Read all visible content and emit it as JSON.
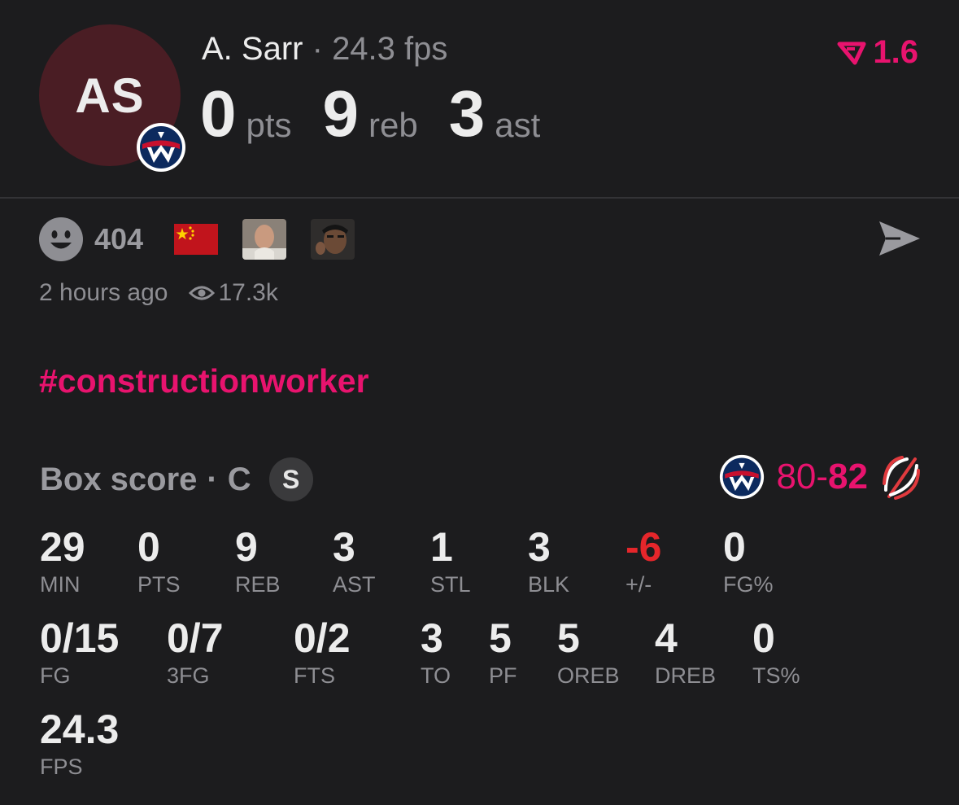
{
  "player": {
    "initials": "AS",
    "name": "A. Sarr",
    "separator": "·",
    "fps_label": "24.3 fps"
  },
  "headline": {
    "pts_value": "0",
    "pts_unit": "pts",
    "reb_value": "9",
    "reb_unit": "reb",
    "ast_value": "3",
    "ast_unit": "ast"
  },
  "rating": {
    "value": "1.6",
    "color": "#e8136e",
    "icon": "v-rating-icon"
  },
  "reactions": {
    "count": "404",
    "icons": [
      "smiley-icon",
      "china-flag-icon",
      "reaction-avatar-1",
      "reaction-avatar-2"
    ],
    "share_icon": "send-icon"
  },
  "meta": {
    "time": "2 hours ago",
    "views": "17.3k"
  },
  "hashtag": "#constructionworker",
  "box_score": {
    "title": "Box score",
    "separator": "·",
    "position": "C",
    "badge": "S",
    "score_away": "80",
    "score_dash": "-",
    "score_home": "82",
    "row1": [
      {
        "value": "29",
        "label": "MIN"
      },
      {
        "value": "0",
        "label": "PTS"
      },
      {
        "value": "9",
        "label": "REB"
      },
      {
        "value": "3",
        "label": "AST"
      },
      {
        "value": "1",
        "label": "STL"
      },
      {
        "value": "3",
        "label": "BLK"
      },
      {
        "value": "-6",
        "label": "+/-"
      },
      {
        "value": "0",
        "label": "FG%"
      }
    ],
    "row2": [
      {
        "value": "0/15",
        "label": "FG"
      },
      {
        "value": "0/7",
        "label": "3FG"
      },
      {
        "value": "0/2",
        "label": "FTS"
      },
      {
        "value": "3",
        "label": "TO"
      },
      {
        "value": "5",
        "label": "PF"
      },
      {
        "value": "5",
        "label": "OREB"
      },
      {
        "value": "4",
        "label": "DREB"
      },
      {
        "value": "0",
        "label": "TS%"
      }
    ],
    "row3": [
      {
        "value": "24.3",
        "label": "FPS"
      }
    ]
  },
  "colors": {
    "background": "#1c1c1e",
    "accent": "#e8136e",
    "negative": "#e5262b",
    "muted": "#8e8e93"
  }
}
